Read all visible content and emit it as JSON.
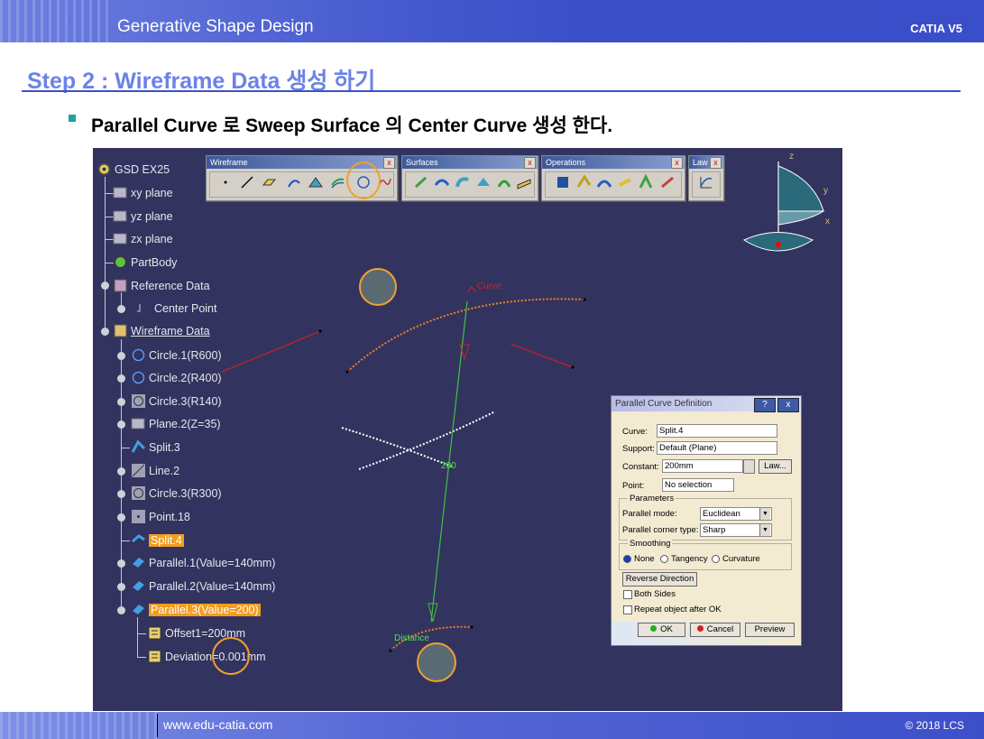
{
  "header": {
    "title": "Generative Shape Design",
    "product": "CATIA V5"
  },
  "step_title": "Step 2 : Wireframe Data 생성 하기",
  "bullet_text": "Parallel Curve 로 Sweep Surface 의 Center Curve 생성 한다.",
  "tree": {
    "root": "GSD EX25",
    "items": [
      "xy plane",
      "yz plane",
      "zx plane",
      "PartBody",
      "Reference Data",
      "Center Point",
      "Wireframe Data",
      "Circle.1(R600)",
      "Circle.2(R400)",
      "Circle.3(R140)",
      "Plane.2(Z=35)",
      "Split.3",
      "Line.2",
      "Circle.3(R300)",
      "Point.18",
      "Split.4",
      "Parallel.1(Value=140mm)",
      "Parallel.2(Value=140mm)",
      "Parallel.3(Value=200)",
      "Offset1=200mm",
      "Deviation=0.001mm"
    ]
  },
  "toolbars": {
    "wireframe": "Wireframe",
    "surfaces": "Surfaces",
    "operations": "Operations",
    "law": "Law",
    "close": "x"
  },
  "compass": {
    "z": "z",
    "y": "y",
    "x": "x"
  },
  "viewport_labels": {
    "curve": "Curve",
    "dimension": "200",
    "distance": "Distance"
  },
  "dialog": {
    "title": "Parallel Curve Definition",
    "help": "?",
    "close": "x",
    "curve_label": "Curve:",
    "curve_value": "Split.4",
    "support_label": "Support:",
    "support_value": "Default (Plane)",
    "constant_label": "Constant:",
    "constant_value": "200mm",
    "law_button": "Law...",
    "point_label": "Point:",
    "point_value": "No selection",
    "parameters_group": "Parameters",
    "parallel_mode_label": "Parallel mode:",
    "parallel_mode_value": "Euclidean",
    "corner_type_label": "Parallel corner type:",
    "corner_type_value": "Sharp",
    "smoothing_group": "Smoothing",
    "smoothing_none": "None",
    "smoothing_tangency": "Tangency",
    "smoothing_curvature": "Curvature",
    "reverse_button": "Reverse Direction",
    "both_sides": "Both Sides",
    "repeat": "Repeat object after OK",
    "ok": "OK",
    "cancel": "Cancel",
    "preview": "Preview"
  },
  "footer": {
    "url": "www.edu-catia.com",
    "copyright": "© 2018 LCS"
  },
  "colors": {
    "viewport": "#33335f",
    "accent": "#3c50c8",
    "highlight": "#f39c1f",
    "marker": "#f0a030"
  }
}
